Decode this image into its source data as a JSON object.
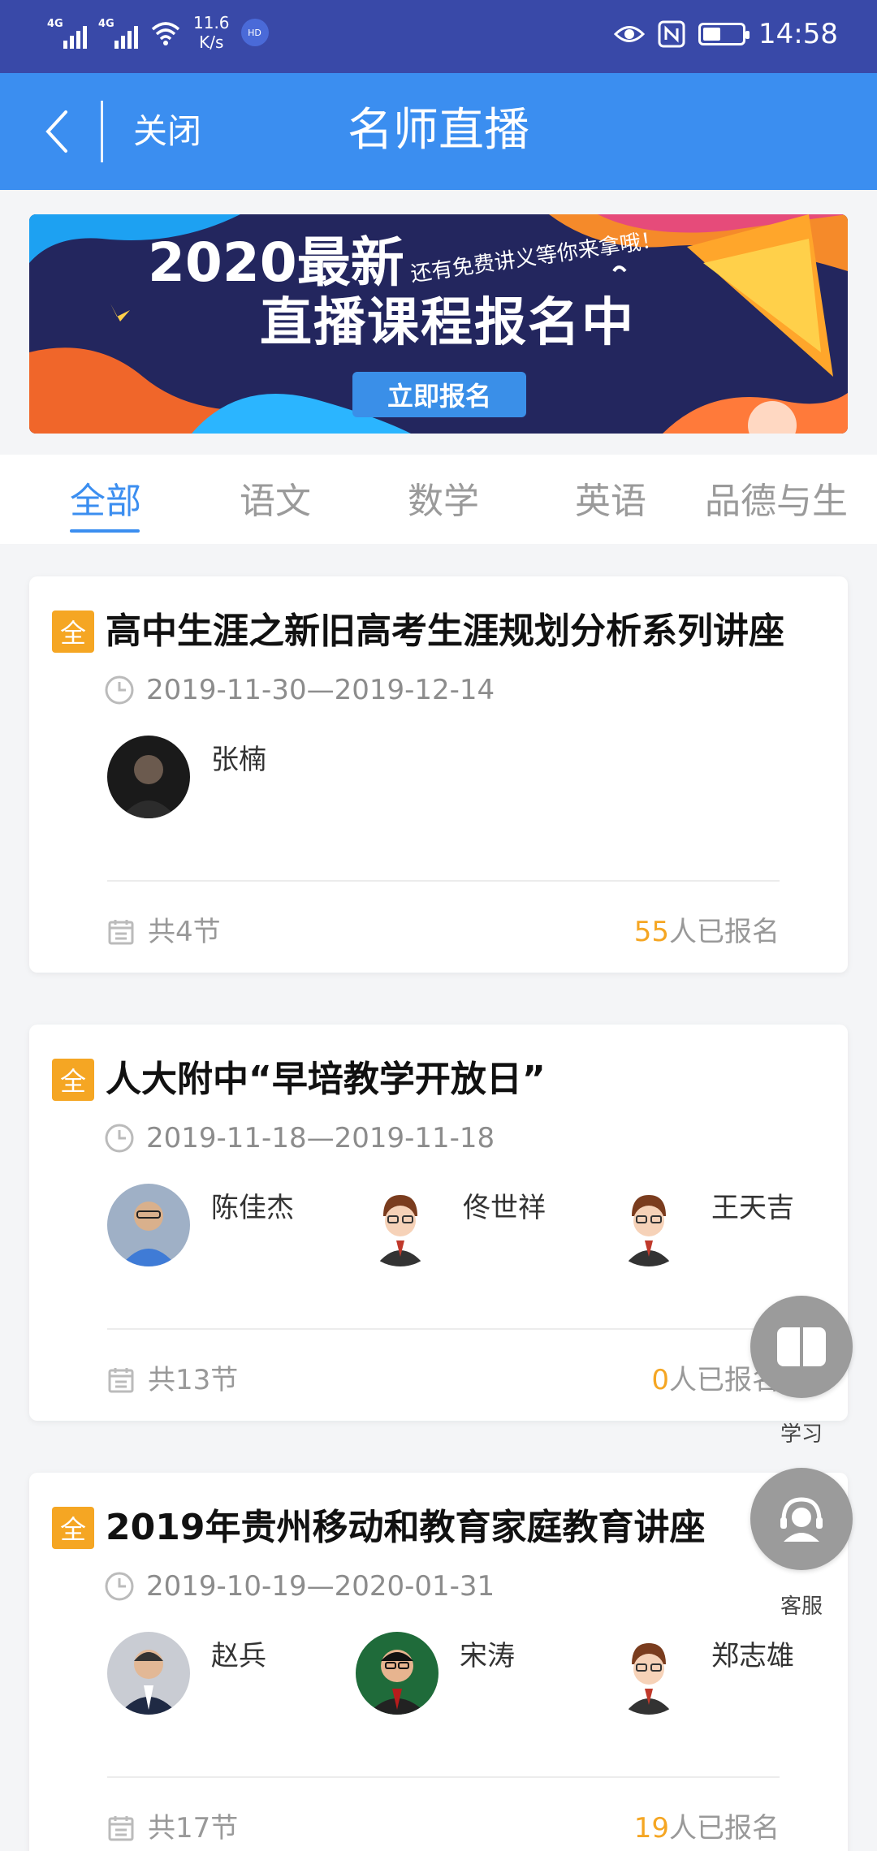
{
  "status_bar": {
    "signal1_label": "4G",
    "signal2_label": "4G",
    "speed_value": "11.6",
    "speed_unit": "K/s",
    "hd_badge": "HD",
    "time": "14:58",
    "battery_level": 0.45,
    "icons": [
      "signal-icon",
      "wifi-icon",
      "eye-icon",
      "nfc-icon",
      "battery-icon"
    ]
  },
  "nav": {
    "close_label": "关闭",
    "title": "名师直播"
  },
  "banner": {
    "year_text": "2020最新",
    "sub_text": "还有免费讲义等你来拿哦！",
    "main_text": "直播课程报名中",
    "button_label": "立即报名"
  },
  "tabs": [
    "全部",
    "语文",
    "数学",
    "英语",
    "品德与生活"
  ],
  "active_tab": 0,
  "courses": [
    {
      "tag": "全",
      "title": "高中生涯之新旧高考生涯规划分析系列讲座",
      "date_range": "2019-11-30—2019-12-14",
      "teachers": [
        {
          "name": "张楠",
          "avatar": "photo-dark"
        }
      ],
      "lessons": "共4节",
      "signup_count": "55",
      "signup_suffix": "人已报名"
    },
    {
      "tag": "全",
      "title": "人大附中“早培教学开放日”",
      "date_range": "2019-11-18—2019-11-18",
      "teachers": [
        {
          "name": "陈佳杰",
          "avatar": "photo-blue"
        },
        {
          "name": "佟世祥",
          "avatar": "cartoon"
        },
        {
          "name": "王天吉",
          "avatar": "cartoon"
        }
      ],
      "lessons": "共13节",
      "signup_count": "0",
      "signup_suffix": "人已报名"
    },
    {
      "tag": "全",
      "title": "2019年贵州移动和教育家庭教育讲座",
      "date_range": "2019-10-19—2020-01-31",
      "teachers": [
        {
          "name": "赵兵",
          "avatar": "photo-suit"
        },
        {
          "name": "宋涛",
          "avatar": "photo-green"
        },
        {
          "name": "郑志雄",
          "avatar": "cartoon"
        }
      ],
      "lessons": "共17节",
      "signup_count": "19",
      "signup_suffix": "人已报名"
    }
  ],
  "floating": {
    "study_label": "学习",
    "service_label": "客服"
  },
  "colors": {
    "status_bar": "#3949a8",
    "nav_bar": "#3b8ef0",
    "accent": "#3b8ef0",
    "tag": "#f5a623",
    "fab": "#9b9b9b"
  }
}
